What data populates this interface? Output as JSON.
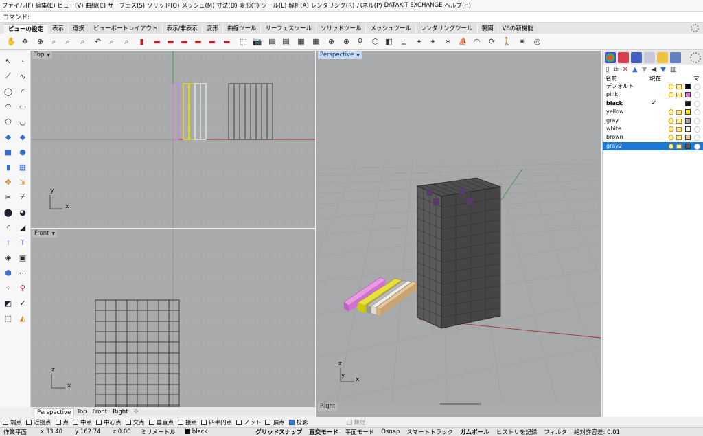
{
  "menu": [
    "ファイル(F)",
    "編集(E)",
    "ビュー(V)",
    "曲線(C)",
    "サーフェス(S)",
    "ソリッド(O)",
    "メッシュ(M)",
    "寸法(D)",
    "変形(T)",
    "ツール(L)",
    "解析(A)",
    "レンダリング(R)",
    "パネル(P)",
    "DATAKIT EXCHANGE",
    "ヘルプ(H)"
  ],
  "command": {
    "prompt": "コマンド:"
  },
  "tabs": [
    "ビューの設定",
    "表示",
    "選択",
    "ビューポートレイアウト",
    "表示/非表示",
    "変形",
    "曲線ツール",
    "サーフェスツール",
    "ソリッドツール",
    "メッシュツール",
    "レンダリングツール",
    "製図",
    "V6の新機能"
  ],
  "viewports": {
    "top": {
      "label": "Top",
      "axis_y": "y",
      "axis_x": "x"
    },
    "front": {
      "label": "Front",
      "axis_y": "z",
      "axis_x": "x"
    },
    "perspective": {
      "label": "Perspective",
      "axis_z": "z",
      "axis_y": "y",
      "axis_x": "x"
    },
    "right": {
      "label": "Right"
    }
  },
  "viewport_tabs": [
    "Perspective",
    "Top",
    "Front",
    "Right"
  ],
  "layer_panel": {
    "col_name": "名前",
    "col_current": "現在",
    "col_mat": "マ",
    "layers": [
      {
        "name": "デフォルト",
        "color": "#000000"
      },
      {
        "name": "pink",
        "color": "#e56ee0"
      },
      {
        "name": "black",
        "color": "#111111",
        "current": true
      },
      {
        "name": "yellow",
        "color": "#ffe800"
      },
      {
        "name": "gray",
        "color": "#aaaaaa"
      },
      {
        "name": "white",
        "color": "#ffffff"
      },
      {
        "name": "brown",
        "color": "#e8c89a"
      },
      {
        "name": "gray2",
        "color": "#555555",
        "selected": true
      }
    ],
    "current_mark": "✓"
  },
  "osnap": {
    "items": [
      {
        "label": "端点",
        "checked": false
      },
      {
        "label": "近接点",
        "checked": false
      },
      {
        "label": "点",
        "checked": false
      },
      {
        "label": "中点",
        "checked": false
      },
      {
        "label": "中心点",
        "checked": false
      },
      {
        "label": "交点",
        "checked": false
      },
      {
        "label": "垂直点",
        "checked": false
      },
      {
        "label": "接点",
        "checked": false
      },
      {
        "label": "四半円点",
        "checked": false
      },
      {
        "label": "ノット",
        "checked": false
      },
      {
        "label": "頂点",
        "checked": false
      },
      {
        "label": "投影",
        "checked": true
      }
    ],
    "disabled_item": "無効"
  },
  "status": {
    "cplane": "作業平面",
    "x": "x 33.40",
    "y": "y 162.74",
    "z": "z 0.00",
    "units": "ミリメートル",
    "layer": "black",
    "grid_snap": "グリッドスナップ",
    "ortho": "直交モード",
    "planar": "平面モード",
    "osnap": "Osnap",
    "smart_track": "スマートトラック",
    "gumball": "ガムボール",
    "history": "ヒストリを記録",
    "filter": "フィルタ",
    "tolerance": "絶対許容差: 0.01"
  }
}
